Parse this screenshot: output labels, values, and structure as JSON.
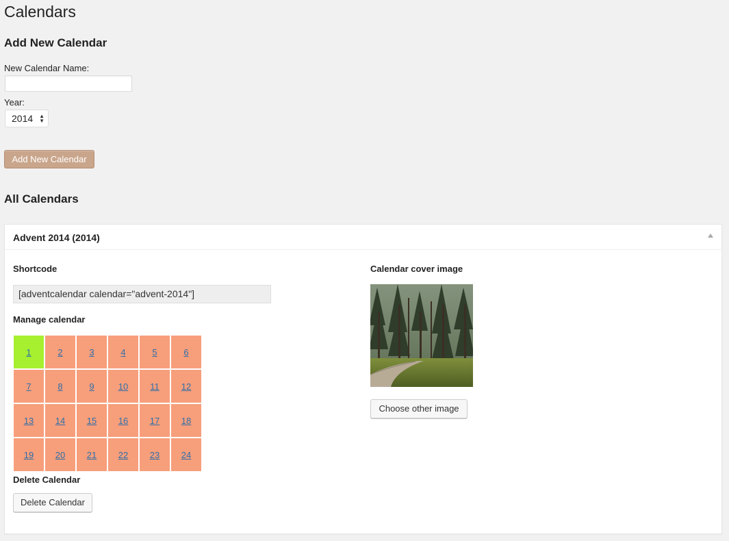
{
  "page": {
    "title": "Calendars"
  },
  "add_form": {
    "heading": "Add New Calendar",
    "name_label": "New Calendar Name:",
    "name_value": "",
    "year_label": "Year:",
    "year_selected": "2014",
    "submit_label": "Add New Calendar"
  },
  "all_calendars": {
    "heading": "All Calendars"
  },
  "calendar": {
    "title": "Advent 2014 (2014)",
    "shortcode_label": "Shortcode",
    "shortcode_value": "[adventcalendar calendar=\"advent-2014\"]",
    "manage_label": "Manage calendar",
    "days": [
      "1",
      "2",
      "3",
      "4",
      "5",
      "6",
      "7",
      "8",
      "9",
      "10",
      "11",
      "12",
      "13",
      "14",
      "15",
      "16",
      "17",
      "18",
      "19",
      "20",
      "21",
      "22",
      "23",
      "24"
    ],
    "active_day": "1",
    "delete_label": "Delete Calendar",
    "delete_button": "Delete Calendar",
    "cover_label": "Calendar cover image",
    "cover_button": "Choose other image"
  },
  "colors": {
    "primary_button": "#c9a58b",
    "day_default": "#f79e7b",
    "day_active": "#a6f030",
    "link": "#2f6fa8"
  },
  "icons": {
    "collapse": "triangle-up-icon",
    "select_arrows": "updown-arrows-icon"
  }
}
